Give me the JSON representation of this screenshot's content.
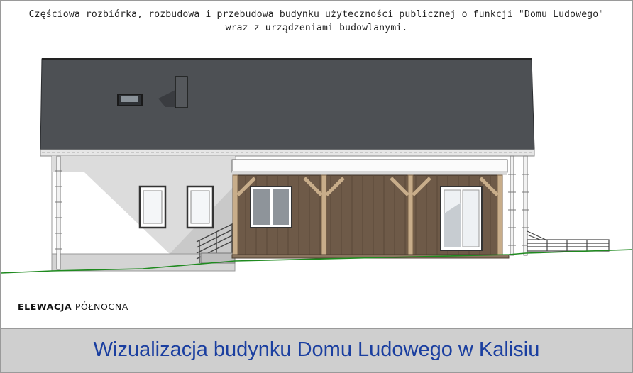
{
  "header": {
    "line1": "Częściowa rozbiórka, rozbudowa i przebudowa budynku użyteczności publicznej o funkcji \"Domu Ludowego\"",
    "line2": "wraz z urządzeniami budowlanymi."
  },
  "elevation": {
    "label_bold": "ELEWACJA",
    "label_regular": "PÓŁNOCNA"
  },
  "footer": {
    "title": "Wizualizacja budynku Domu Ludowego w Kalisiu"
  },
  "colors": {
    "roof": "#4d5054",
    "wood": "#6e5a48",
    "ground_line": "#1f8a1f",
    "footer_text": "#1b3fa0",
    "footer_bg": "#cfcfcf"
  }
}
